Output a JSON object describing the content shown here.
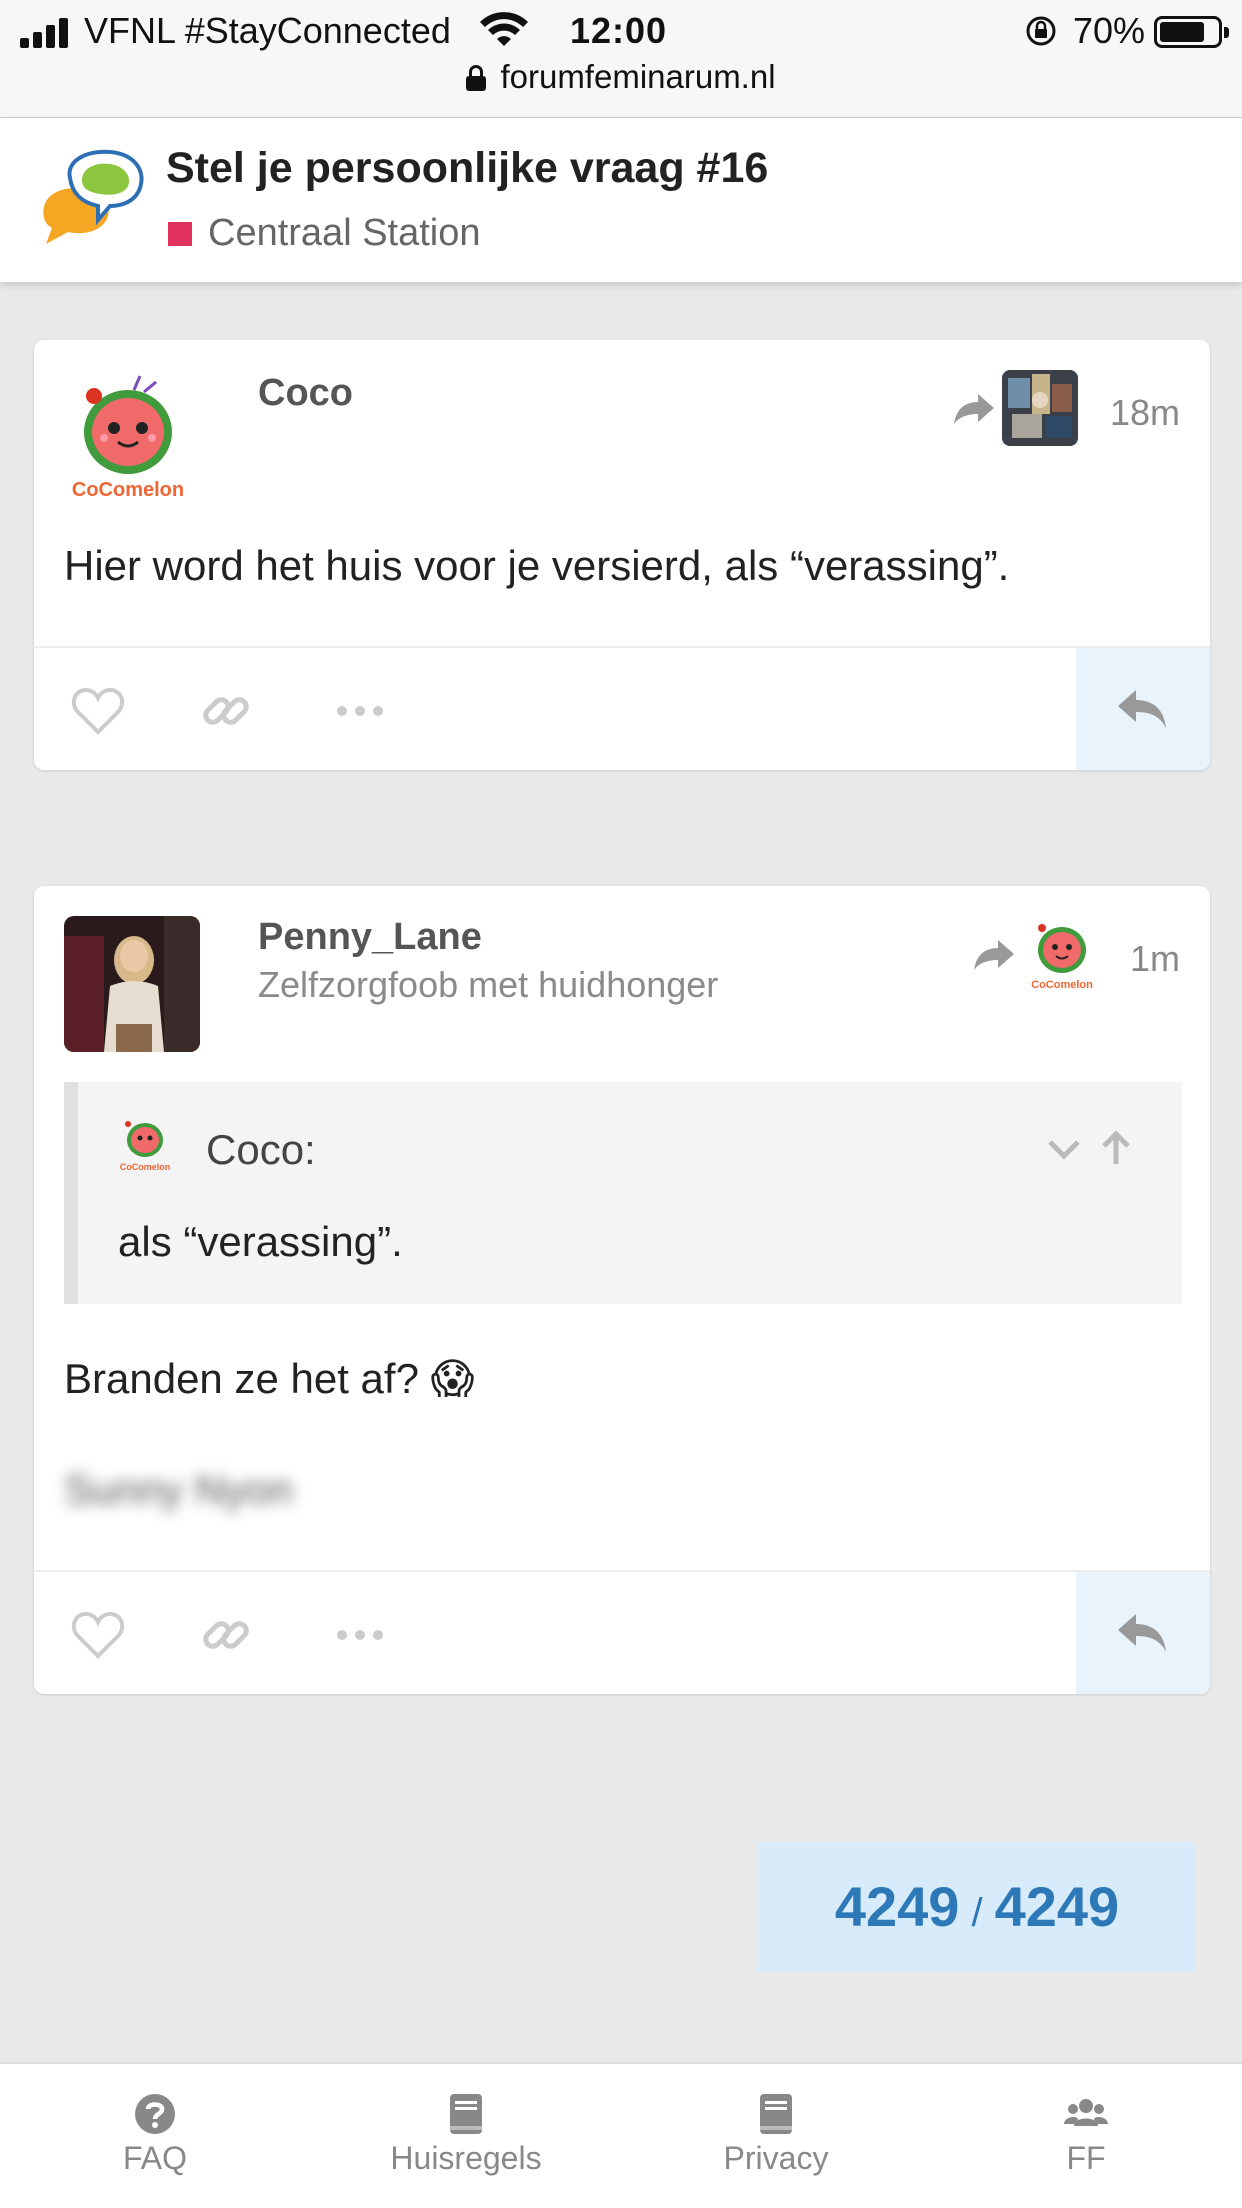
{
  "status_bar": {
    "carrier": "VFNL #StayConnected",
    "time": "12:00",
    "battery": "70%",
    "url": "forumfeminarum.nl"
  },
  "header": {
    "title": "Stel je persoonlijke vraag #16",
    "category": "Centraal Station",
    "category_color": "#e0325d"
  },
  "posts": [
    {
      "username": "Coco",
      "avatar_icon": "cocomelon-avatar",
      "avatar_label": "CoComelon",
      "time": "18m",
      "body": "Hier word het huis voor je versierd, als “verassing”."
    },
    {
      "username": "Penny_Lane",
      "user_title": "Zelfzorgfoob met huidhonger",
      "time": "1m",
      "quote": {
        "user": "Coco:",
        "text": "als “verassing”."
      },
      "body": "Branden ze het af?",
      "body_emoji": "😱",
      "signature": "Sunny Nyon"
    }
  ],
  "progress": {
    "current": "4249",
    "separator": "/",
    "total": "4249"
  },
  "footer_nav": [
    {
      "label": "FAQ",
      "icon": "question-circle-icon"
    },
    {
      "label": "Huisregels",
      "icon": "book-icon"
    },
    {
      "label": "Privacy",
      "icon": "book-icon"
    },
    {
      "label": "FF",
      "icon": "users-icon"
    }
  ],
  "colors": {
    "accent": "#2d79b8",
    "reply_bg": "#e8f3fb",
    "page_bg": "#e9e9e9"
  }
}
